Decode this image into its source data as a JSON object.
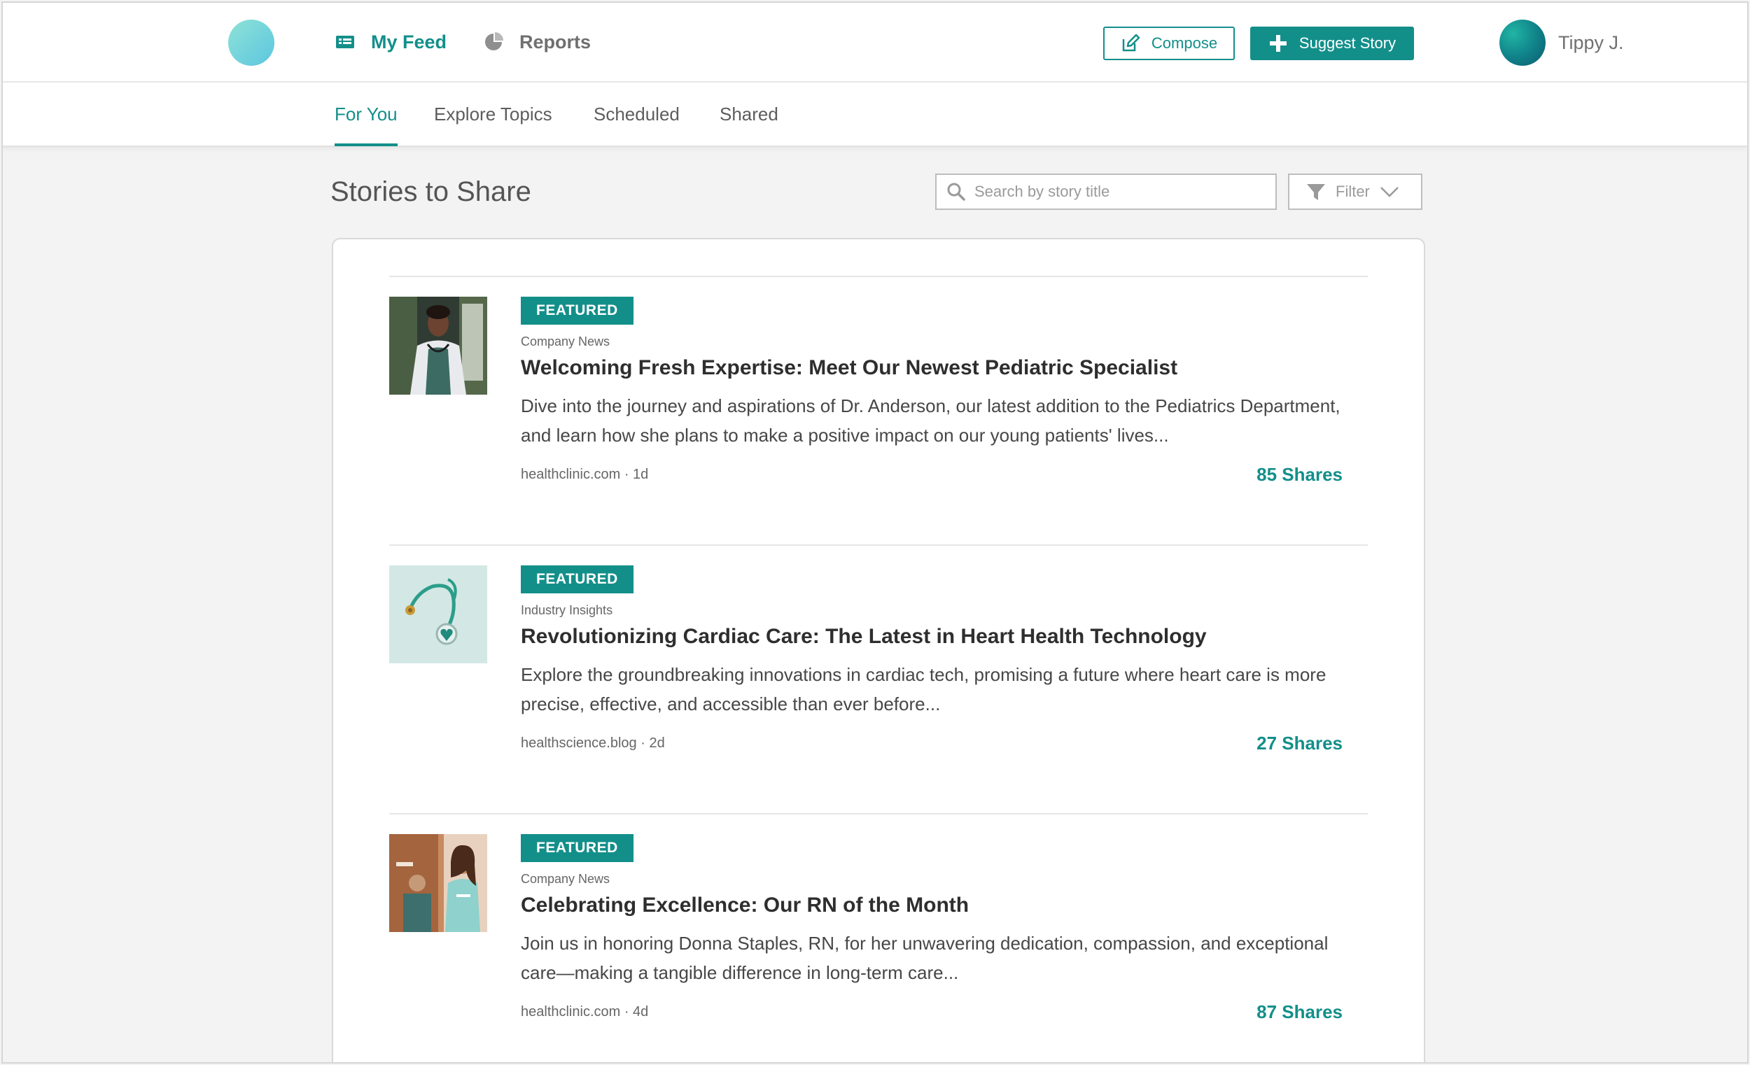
{
  "colors": {
    "accent": "#138f8a",
    "background": "#f3f3f3"
  },
  "header": {
    "nav": [
      {
        "label": "My Feed",
        "icon": "feed-icon"
      },
      {
        "label": "Reports",
        "icon": "pie-chart-icon"
      }
    ],
    "compose_label": "Compose",
    "suggest_label": "Suggest Story",
    "user_name": "Tippy J."
  },
  "tabs": [
    {
      "label": "For You",
      "active": true
    },
    {
      "label": "Explore Topics",
      "active": false
    },
    {
      "label": "Scheduled",
      "active": false
    },
    {
      "label": "Shared",
      "active": false
    }
  ],
  "main": {
    "title": "Stories to Share",
    "search_placeholder": "Search by story title",
    "filter_label": "Filter"
  },
  "stories": [
    {
      "badge": "FEATURED",
      "category": "Company News",
      "title": "Welcoming Fresh Expertise: Meet Our Newest Pediatric Specialist",
      "summary": "Dive into the journey and aspirations of Dr. Anderson, our latest addition to the Pediatrics Department, and learn how she plans to make a positive impact on our young patients' lives...",
      "source": "healthclinic.com · 1d",
      "shares": "85 Shares",
      "thumb": "doctor-photo"
    },
    {
      "badge": "FEATURED",
      "category": "Industry Insights",
      "title": "Revolutionizing Cardiac Care: The Latest in Heart Health Technology",
      "summary": "Explore the groundbreaking innovations in cardiac tech, promising a future where heart care is more precise, effective, and accessible than ever before...",
      "source": "healthscience.blog · 2d",
      "shares": "27 Shares",
      "thumb": "stethoscope-photo"
    },
    {
      "badge": "FEATURED",
      "category": "Company News",
      "title": "Celebrating Excellence: Our RN of the Month",
      "summary": "Join us in honoring Donna Staples, RN, for her unwavering dedication, compassion, and exceptional care—making a tangible difference in long-term care...",
      "source": "healthclinic.com · 4d",
      "shares": "87 Shares",
      "thumb": "nurse-photo"
    }
  ]
}
